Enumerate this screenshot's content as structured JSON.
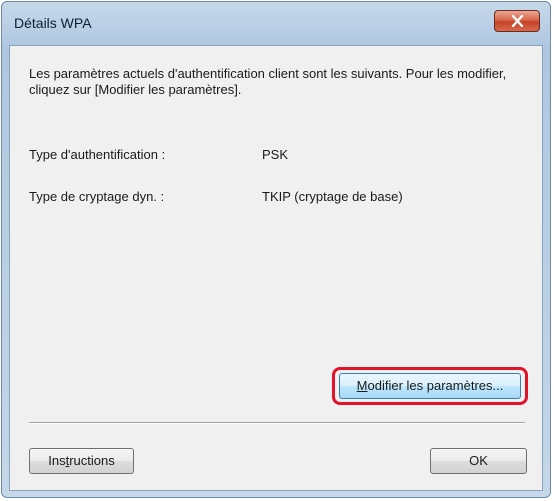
{
  "window": {
    "title": "Détails WPA"
  },
  "icons": {
    "close": "close-icon"
  },
  "colors": {
    "highlight": "#e2122a",
    "close_button": "#c4432a"
  },
  "content": {
    "description": "Les paramètres actuels d'authentification client sont les suivants. Pour les modifier, cliquez sur [Modifier les paramètres].",
    "auth_type_label": "Type d'authentification :",
    "auth_type_value": "PSK",
    "encryption_label": "Type de cryptage dyn. :",
    "encryption_value": "TKIP (cryptage de base)"
  },
  "buttons": {
    "modify_prefix": "M",
    "modify_rest": "odifier les paramètres...",
    "instructions_before": "Ins",
    "instructions_underlined": "t",
    "instructions_after": "ructions",
    "ok": "OK"
  }
}
